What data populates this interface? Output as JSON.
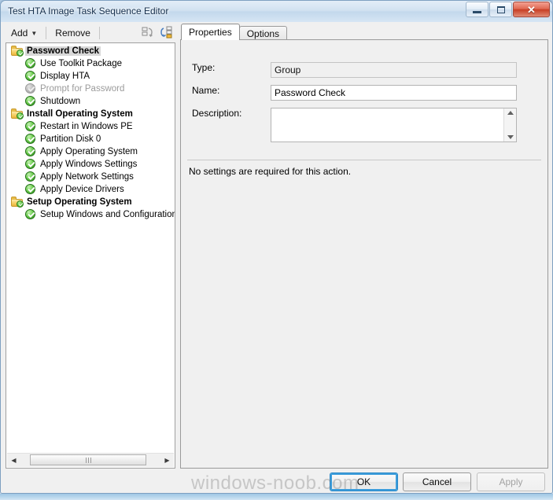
{
  "window": {
    "title": "Test HTA Image Task Sequence Editor",
    "controls": {
      "minimize": "minimize-icon",
      "maximize": "maximize-icon",
      "close": "✕"
    }
  },
  "toolbar": {
    "add_label": "Add",
    "add_caret": "▼",
    "remove_label": "Remove",
    "icon_collapse": "collapse-all-icon",
    "icon_expand": "expand-all-icon"
  },
  "tree": {
    "items": [
      {
        "label": "Password Check",
        "type": "group",
        "icon": "folder-check-icon",
        "enabled": true,
        "selected": true
      },
      {
        "label": "Use Toolkit Package",
        "type": "action",
        "icon": "green-check-icon",
        "enabled": true,
        "selected": false
      },
      {
        "label": "Display HTA",
        "type": "action",
        "icon": "green-check-icon",
        "enabled": true,
        "selected": false
      },
      {
        "label": "Prompt for Password",
        "type": "action",
        "icon": "gray-check-icon",
        "enabled": false,
        "selected": false
      },
      {
        "label": "Shutdown",
        "type": "action",
        "icon": "green-check-icon",
        "enabled": true,
        "selected": false
      },
      {
        "label": "Install Operating System",
        "type": "group",
        "icon": "folder-check-icon",
        "enabled": true,
        "selected": false
      },
      {
        "label": "Restart in Windows PE",
        "type": "action",
        "icon": "green-check-icon",
        "enabled": true,
        "selected": false
      },
      {
        "label": "Partition Disk 0",
        "type": "action",
        "icon": "green-check-icon",
        "enabled": true,
        "selected": false
      },
      {
        "label": "Apply Operating System",
        "type": "action",
        "icon": "green-check-icon",
        "enabled": true,
        "selected": false
      },
      {
        "label": "Apply Windows Settings",
        "type": "action",
        "icon": "green-check-icon",
        "enabled": true,
        "selected": false
      },
      {
        "label": "Apply Network Settings",
        "type": "action",
        "icon": "green-check-icon",
        "enabled": true,
        "selected": false
      },
      {
        "label": "Apply Device Drivers",
        "type": "action",
        "icon": "green-check-icon",
        "enabled": true,
        "selected": false
      },
      {
        "label": "Setup Operating System",
        "type": "group",
        "icon": "folder-check-icon",
        "enabled": true,
        "selected": false
      },
      {
        "label": "Setup Windows and Configuration",
        "type": "action",
        "icon": "green-check-icon",
        "enabled": true,
        "selected": false
      }
    ],
    "scrollbar": {
      "left_arrow": "◀",
      "right_arrow": "▶"
    }
  },
  "tabs": [
    {
      "label": "Properties",
      "active": true
    },
    {
      "label": "Options",
      "active": false
    }
  ],
  "properties": {
    "type_label": "Type:",
    "type_value": "Group",
    "name_label": "Name:",
    "name_value": "Password Check",
    "description_label": "Description:",
    "description_value": "",
    "note": "No settings are required  for this action."
  },
  "footer": {
    "ok_label": "OK",
    "cancel_label": "Cancel",
    "apply_label": "Apply"
  },
  "watermark": "windows-noob.com"
}
